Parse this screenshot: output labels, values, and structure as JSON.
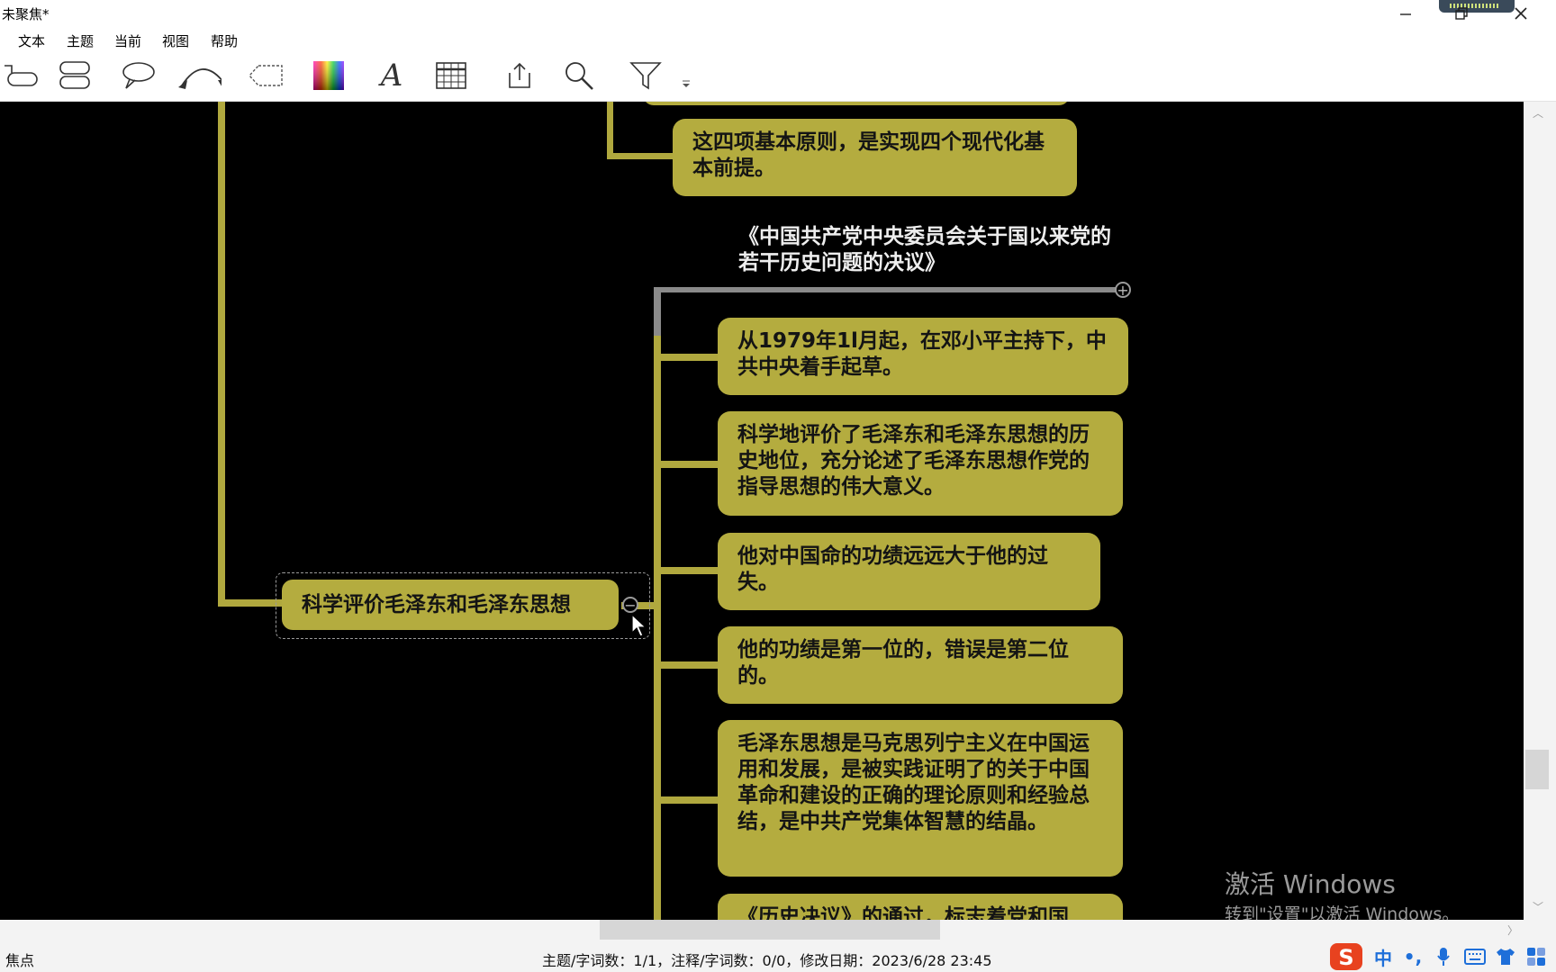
{
  "window": {
    "title": "未聚焦*"
  },
  "menu": {
    "items": [
      "文本",
      "主题",
      "当前",
      "视图",
      "帮助"
    ]
  },
  "toolbar": {
    "tools": [
      "topic-icon",
      "subtopic-icon",
      "callout-icon",
      "relationship-icon",
      "boundary-icon",
      "color-palette-icon",
      "text-style-icon",
      "table-icon",
      "export-icon",
      "search-icon",
      "filter-icon",
      "more-dropdown-icon"
    ]
  },
  "mindmap": {
    "top_node": "这四项基本原则，是实现四个现代化基本前提。",
    "floating_title": "《中国共产党中央委员会关于国以来党的若干历史问题的决议》",
    "central_node": "科学评价毛泽东和毛泽东思想",
    "children": [
      "从1979年1l月起，在邓小平主持下，中共中央着手起草。",
      "科学地评价了毛泽东和毛泽东思想的历史地位，充分论述了毛泽东思想作党的指导思想的伟大意义。",
      "他对中国命的功绩远远大于他的过失。",
      "他的功绩是第一位的，错误是第二位的。",
      "毛泽东思想是马克思列宁主义在中国运用和发展，是被实践证明了的关于中国革命和建设的正确的理论原则和经验总结，是中共产党集体智慧的结晶。",
      "《历史决议》的通过，标志着党和国"
    ],
    "colors": {
      "node": "#b4ac3f",
      "line": "#b0a83e",
      "canvas": "#000000"
    }
  },
  "watermark": {
    "line1": "激活 Windows",
    "line2": "转到\"设置\"以激活 Windows。"
  },
  "status": {
    "left": "焦点",
    "center": "主题/字词数：1/1，注释/字词数：0/0，修改日期：2023/6/28 23:45"
  },
  "tray": {
    "ime": "中",
    "punct": "•,"
  }
}
